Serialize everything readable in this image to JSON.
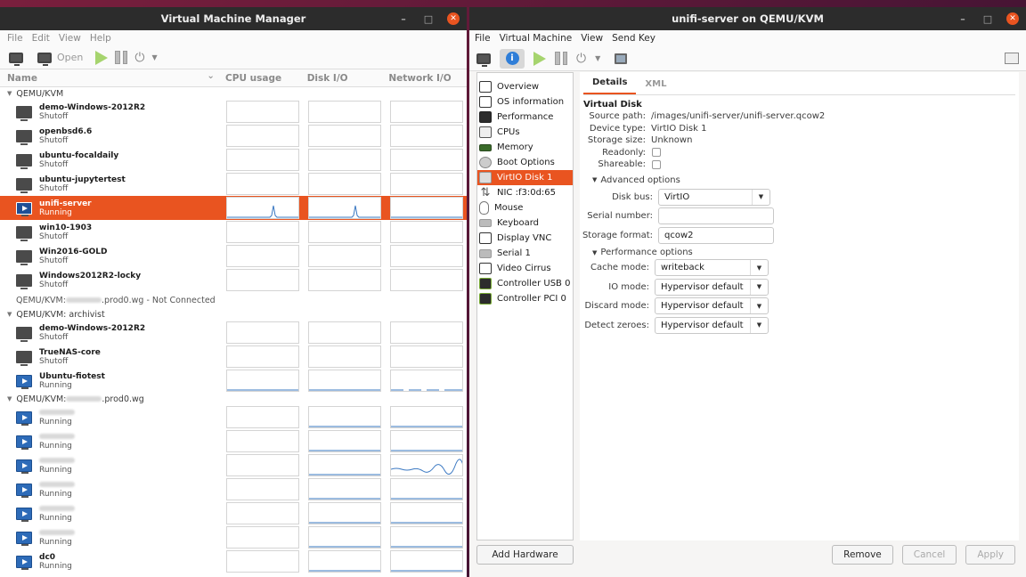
{
  "manager": {
    "title": "Virtual Machine Manager",
    "menu": [
      "File",
      "Edit",
      "View",
      "Help"
    ],
    "toolbar": {
      "open_label": "Open"
    },
    "columns": {
      "name": "Name",
      "cpu": "CPU usage",
      "disk": "Disk I/O",
      "net": "Network I/O"
    },
    "groups": [
      {
        "label": "QEMU/KVM",
        "vms": [
          {
            "name": "demo-Windows-2012R2",
            "status": "Shutoff"
          },
          {
            "name": "openbsd6.6",
            "status": "Shutoff"
          },
          {
            "name": "ubuntu-focaldaily",
            "status": "Shutoff"
          },
          {
            "name": "ubuntu-jupytertest",
            "status": "Shutoff"
          },
          {
            "name": "unifi-server",
            "status": "Running"
          },
          {
            "name": "win10-1903",
            "status": "Shutoff"
          },
          {
            "name": "Win2016-GOLD",
            "status": "Shutoff"
          },
          {
            "name": "Windows2012R2-locky",
            "status": "Shutoff"
          }
        ]
      },
      {
        "label": "QEMU/KVM: archivist",
        "vms": [
          {
            "name": "demo-Windows-2012R2",
            "status": "Shutoff"
          },
          {
            "name": "TrueNAS-core",
            "status": "Shutoff"
          },
          {
            "name": "Ubuntu-fiotest",
            "status": "Running"
          }
        ]
      },
      {
        "label_prefix": "QEMU/KVM:",
        "label_suffix": ".prod0.wg",
        "vms": [
          {
            "name": "",
            "status": "Running"
          },
          {
            "name": "",
            "status": "Running"
          },
          {
            "name": "",
            "status": "Running"
          },
          {
            "name": "",
            "status": "Running"
          },
          {
            "name": "",
            "status": "Running"
          },
          {
            "name": "",
            "status": "Running"
          },
          {
            "name": "dc0",
            "status": "Running"
          }
        ]
      }
    ],
    "not_connected": {
      "prefix": "QEMU/KVM:",
      "suffix": ".prod0.wg - Not Connected"
    }
  },
  "detail": {
    "title": "unifi-server on QEMU/KVM",
    "menu": [
      "File",
      "Virtual Machine",
      "View",
      "Send Key"
    ],
    "sidebar": [
      {
        "label": "Overview",
        "icon": "monitor-icon"
      },
      {
        "label": "OS information",
        "icon": "monitor-icon"
      },
      {
        "label": "Performance",
        "icon": "performance-icon"
      },
      {
        "label": "CPUs",
        "icon": "cpu-icon"
      },
      {
        "label": "Memory",
        "icon": "memory-icon"
      },
      {
        "label": "Boot Options",
        "icon": "boot-icon"
      },
      {
        "label": "VirtIO Disk 1",
        "icon": "disk-icon"
      },
      {
        "label": "NIC :f3:0d:65",
        "icon": "nic-icon"
      },
      {
        "label": "Mouse",
        "icon": "mouse-icon"
      },
      {
        "label": "Keyboard",
        "icon": "keyboard-icon"
      },
      {
        "label": "Display VNC",
        "icon": "monitor-icon"
      },
      {
        "label": "Serial 1",
        "icon": "serial-icon"
      },
      {
        "label": "Video Cirrus",
        "icon": "monitor-icon"
      },
      {
        "label": "Controller USB 0",
        "icon": "usb-icon"
      },
      {
        "label": "Controller PCI 0",
        "icon": "usb-icon"
      }
    ],
    "add_hardware": "Add Hardware",
    "tabs": [
      "Details",
      "XML"
    ],
    "section": "Virtual Disk",
    "info": {
      "source_path_label": "Source path:",
      "source_path": "/images/unifi-server/unifi-server.qcow2",
      "device_type_label": "Device type:",
      "device_type": "VirtIO Disk 1",
      "storage_size_label": "Storage size:",
      "storage_size": "Unknown",
      "readonly_label": "Readonly:",
      "shareable_label": "Shareable:"
    },
    "advanced": {
      "label": "Advanced options",
      "disk_bus_label": "Disk bus:",
      "disk_bus": "VirtIO",
      "serial_label": "Serial number:",
      "serial": "",
      "format_label": "Storage format:",
      "format": "qcow2"
    },
    "performance": {
      "label": "Performance options",
      "cache_label": "Cache mode:",
      "cache": "writeback",
      "io_label": "IO mode:",
      "io": "Hypervisor default",
      "discard_label": "Discard mode:",
      "discard": "Hypervisor default",
      "zeroes_label": "Detect zeroes:",
      "zeroes": "Hypervisor default"
    },
    "buttons": {
      "remove": "Remove",
      "cancel": "Cancel",
      "apply": "Apply"
    }
  },
  "colors": {
    "accent": "#e95420",
    "titlebar": "#2c2c2c",
    "graph_line": "#3a78c2"
  }
}
